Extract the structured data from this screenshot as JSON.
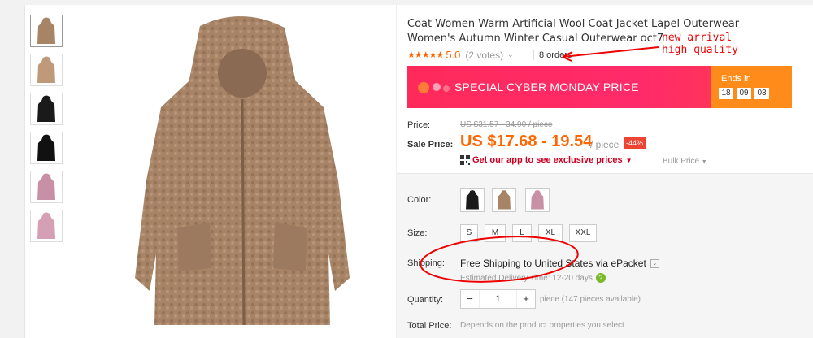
{
  "product": {
    "title": "Coat Women Warm Artificial Wool Coat Jacket Lapel Outerwear Women's Autumn Winter Casual Outerwear oct7",
    "stars": "★★★★★",
    "score": "5.0",
    "votes": "(2 votes)",
    "orders": "8 orders"
  },
  "annotation": {
    "line1": "new arrival",
    "line2": "high quality"
  },
  "banner": {
    "text": "SPECIAL CYBER MONDAY PRICE",
    "ends_label": "Ends in",
    "hours": "18",
    "minutes": "09",
    "seconds": "03"
  },
  "price": {
    "label": "Price:",
    "old": "US $31.57 - 34.90 / piece",
    "sale_label": "Sale Price:",
    "sale": "US $17.68 - 19.54",
    "unit": "/ piece",
    "discount": "-44%",
    "app_prefix": "",
    "app_text": "Get our app to see exclusive prices",
    "bulk": "Bulk Price"
  },
  "options": {
    "color_label": "Color:",
    "size_label": "Size:",
    "sizes": [
      "S",
      "M",
      "L",
      "XL",
      "XXL"
    ],
    "shipping_label": "Shipping:",
    "shipping_main": "Free Shipping to United States via ePacket",
    "shipping_sub": "Estimated Delivery Time: 12-20 days",
    "quantity_label": "Quantity:",
    "quantity": "1",
    "availability": "piece (147 pieces available)",
    "total_label": "Total Price:",
    "total_note": "Depends on the product properties you select"
  },
  "colors": {
    "coat_tan": "#a88466",
    "coat_black": "#1a1a1a",
    "coat_pink": "#c890a4",
    "accent": "#ff6600",
    "annotation_red": "#e00000"
  }
}
